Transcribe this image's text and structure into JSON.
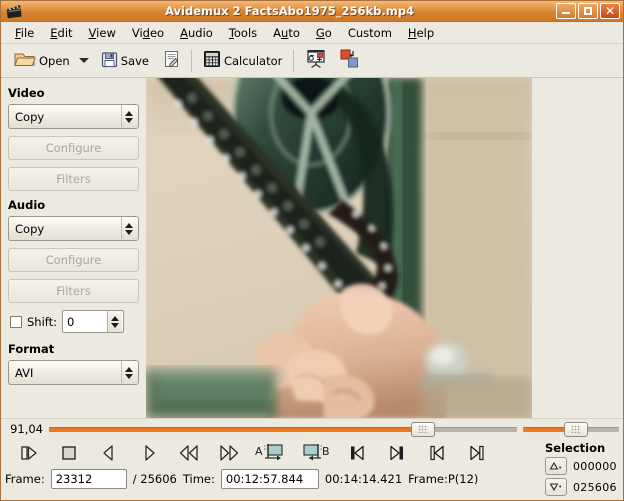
{
  "window": {
    "icon": "film-clapper-icon",
    "title": "Avidemux 2 FactsAbo1975_256kb.mp4",
    "minimize_label": "Minimize",
    "maximize_label": "Maximize",
    "close_label": "✕",
    "titlebar_color": "#d9822f",
    "accent_color": "#f07820"
  },
  "menubar": {
    "items": [
      {
        "label": "File",
        "mnemonic": "F"
      },
      {
        "label": "Edit",
        "mnemonic": "E"
      },
      {
        "label": "View",
        "mnemonic": "V"
      },
      {
        "label": "Video",
        "mnemonic": "d"
      },
      {
        "label": "Audio",
        "mnemonic": "A"
      },
      {
        "label": "Tools",
        "mnemonic": "T"
      },
      {
        "label": "Auto",
        "mnemonic": "u"
      },
      {
        "label": "Go",
        "mnemonic": "G"
      },
      {
        "label": "Custom",
        "mnemonic": ""
      },
      {
        "label": "Help",
        "mnemonic": "H"
      }
    ]
  },
  "toolbar": {
    "open_label": "Open",
    "open_icon": "open-folder-icon",
    "open_dropdown_icon": "chevron-down-icon",
    "save_label": "Save",
    "save_icon": "floppy-disk-icon",
    "script_icon": "script-document-icon",
    "calculator_label": "Calculator",
    "calculator_icon": "calculator-icon",
    "projector_icon": "projector-screen-icon",
    "shift_squares_icon": "shift-squares-icon"
  },
  "sidebar": {
    "video": {
      "title": "Video",
      "codec_value": "Copy",
      "configure_label": "Configure",
      "filters_label": "Filters"
    },
    "audio": {
      "title": "Audio",
      "codec_value": "Copy",
      "configure_label": "Configure",
      "filters_label": "Filters",
      "shift_label": "Shift:",
      "shift_value": "0",
      "shift_checked": false
    },
    "format": {
      "title": "Format",
      "value": "AVI"
    }
  },
  "preview": {
    "description": "video-preview-film-reel"
  },
  "transport": {
    "zoom_value": "91,04",
    "main_slider_percent": 80,
    "small_slider_percent": 55,
    "buttons": [
      {
        "name": "play-button",
        "icon": "play-icon"
      },
      {
        "name": "stop-button",
        "icon": "stop-icon"
      },
      {
        "name": "previous-frame-button",
        "icon": "prev-frame-icon"
      },
      {
        "name": "next-frame-button",
        "icon": "next-frame-icon"
      },
      {
        "name": "rewind-button",
        "icon": "rewind-icon"
      },
      {
        "name": "fast-forward-button",
        "icon": "fast-forward-icon"
      },
      {
        "name": "mark-a-button",
        "icon": "mark-a-icon",
        "label": "A"
      },
      {
        "name": "mark-b-button",
        "icon": "mark-b-icon",
        "label": "B"
      },
      {
        "name": "prev-keyframe-button",
        "icon": "prev-keyframe-icon"
      },
      {
        "name": "next-keyframe-button",
        "icon": "next-keyframe-icon"
      },
      {
        "name": "go-start-button",
        "icon": "go-to-start-icon"
      },
      {
        "name": "go-end-button",
        "icon": "go-to-end-icon"
      }
    ]
  },
  "statusbar": {
    "frame_label": "Frame:",
    "frame_value": "23312",
    "frame_total": "/ 25606",
    "time_label": "Time:",
    "time_value": "00:12:57.844",
    "total_time": "00:14:14.421",
    "frame_type": "Frame:P(12)"
  },
  "selection": {
    "title": "Selection",
    "start_icon": "selection-start-icon",
    "start_value": "000000",
    "end_icon": "selection-end-icon",
    "end_value": "025606"
  }
}
